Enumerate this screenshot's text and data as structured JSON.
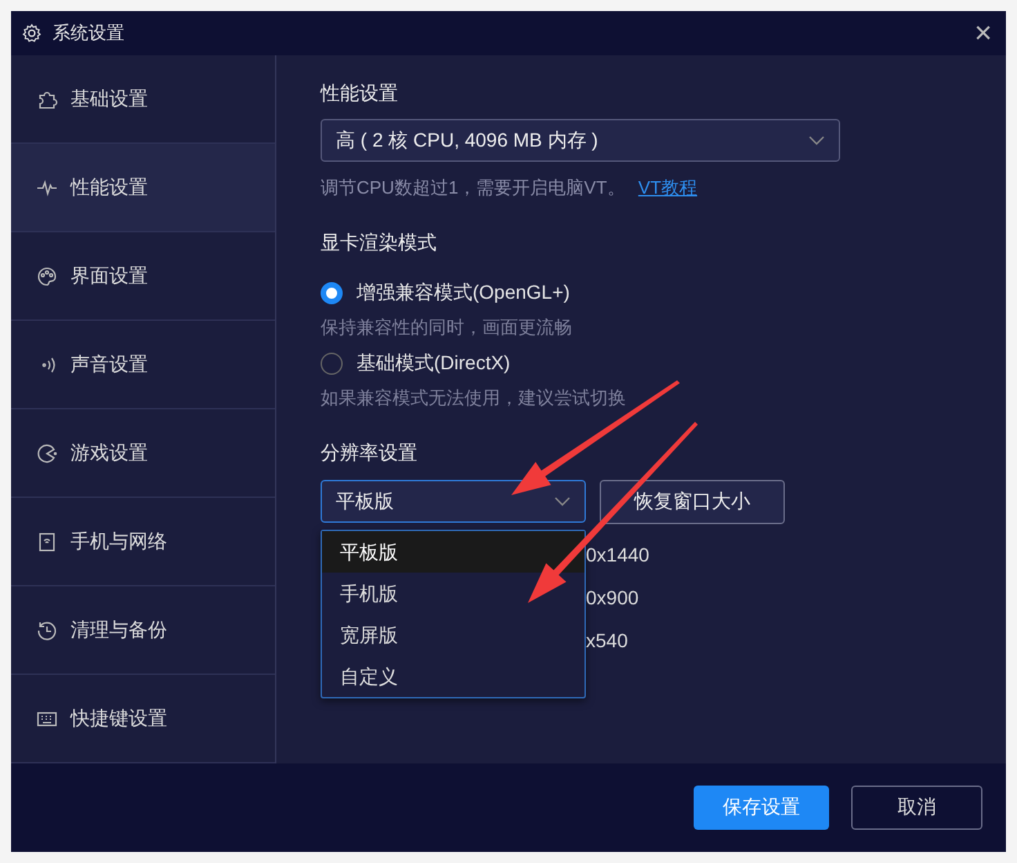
{
  "window": {
    "title": "系统设置",
    "close": "×"
  },
  "sidebar": {
    "items": [
      {
        "label": "基础设置",
        "selected": false
      },
      {
        "label": "性能设置",
        "selected": true
      },
      {
        "label": "界面设置",
        "selected": false
      },
      {
        "label": "声音设置",
        "selected": false
      },
      {
        "label": "游戏设置",
        "selected": false
      },
      {
        "label": "手机与网络",
        "selected": false
      },
      {
        "label": "清理与备份",
        "selected": false
      },
      {
        "label": "快捷键设置",
        "selected": false
      }
    ]
  },
  "performance": {
    "heading": "性能设置",
    "select": {
      "value": "高 ( 2 核 CPU, 4096 MB 内存 )"
    },
    "hint": "调节CPU数超过1，需要开启电脑VT。",
    "link": "VT教程"
  },
  "render_mode": {
    "heading": "显卡渲染模式",
    "options": [
      {
        "label": "增强兼容模式(OpenGL+)",
        "hint": "保持兼容性的同时，画面更流畅",
        "selected": true
      },
      {
        "label": "基础模式(DirectX)",
        "hint": "如果兼容模式无法使用，建议尝试切换",
        "selected": false
      }
    ]
  },
  "resolution": {
    "heading": "分辨率设置",
    "select": {
      "value": "平板版",
      "expanded": true
    },
    "reset_button": "恢复窗口大小",
    "dropdown_options": [
      {
        "label": "平板版",
        "selected": true
      },
      {
        "label": "手机版",
        "selected": false
      },
      {
        "label": "宽屏版",
        "selected": false
      },
      {
        "label": "自定义",
        "selected": false
      }
    ],
    "covered_sizes": [
      "0x1440",
      "0x900",
      "x540"
    ]
  },
  "footer": {
    "buttons": [
      {
        "label": "保存设置",
        "kind": "primary"
      },
      {
        "label": "取消",
        "kind": "secondary"
      }
    ]
  }
}
